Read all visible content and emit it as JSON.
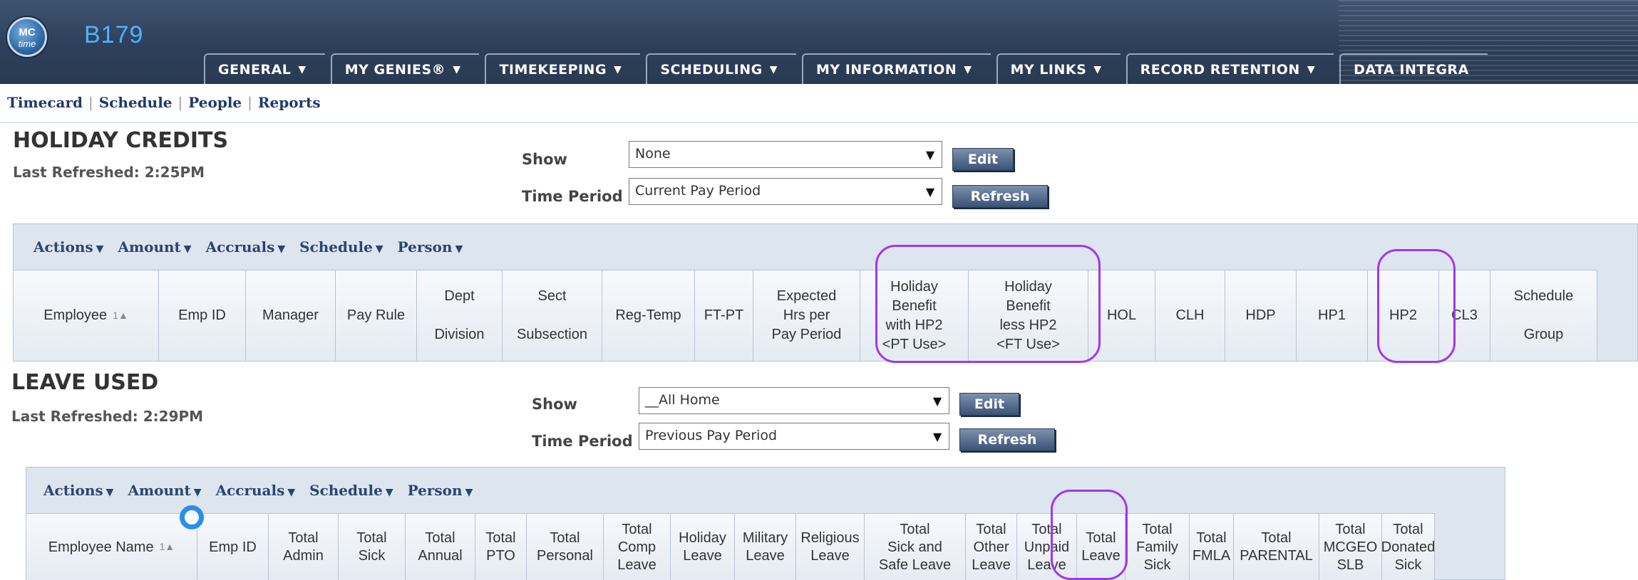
{
  "header": {
    "logo_line1": "MC",
    "logo_line2": "time",
    "site_code": "B179",
    "menu": [
      {
        "label": "GENERAL"
      },
      {
        "label": "MY GENIES®"
      },
      {
        "label": "TIMEKEEPING"
      },
      {
        "label": "SCHEDULING"
      },
      {
        "label": "MY INFORMATION"
      },
      {
        "label": "MY LINKS"
      },
      {
        "label": "RECORD RETENTION"
      },
      {
        "label": "DATA INTEGRA"
      }
    ]
  },
  "subnav": [
    "Timecard",
    "Schedule",
    "People",
    "Reports"
  ],
  "holiday_credits": {
    "title": "HOLIDAY CREDITS",
    "last_refreshed": "Last Refreshed: 2:25PM",
    "show_label": "Show",
    "show_value": "None",
    "edit_label": "Edit",
    "time_period_label": "Time Period",
    "time_period_value": "Current Pay Period",
    "refresh_label": "Refresh",
    "toolbar": [
      "Actions",
      "Amount",
      "Accruals",
      "Schedule",
      "Person"
    ],
    "sort_indicator": "1",
    "columns": [
      "Employee",
      "Emp ID",
      "Manager",
      "Pay Rule",
      "Dept\n\nDivision",
      "Sect\n\nSubsection",
      "Reg-Temp",
      "FT-PT",
      "Expected\nHrs per\nPay Period",
      "Holiday\nBenefit\nwith HP2\n<PT Use>",
      "Holiday\nBenefit\nless HP2\n<FT Use>",
      "HOL",
      "CLH",
      "HDP",
      "HP1",
      "HP2",
      "CL3",
      "Schedule\n\nGroup"
    ]
  },
  "leave_used": {
    "title": "LEAVE USED",
    "last_refreshed": "Last Refreshed: 2:29PM",
    "show_label": "Show",
    "show_value": "__All Home",
    "edit_label": "Edit",
    "time_period_label": "Time Period",
    "time_period_value": "Previous Pay Period",
    "refresh_label": "Refresh",
    "toolbar": [
      "Actions",
      "Amount",
      "Accruals",
      "Schedule",
      "Person"
    ],
    "sort_indicator": "1",
    "columns": [
      "Employee Name",
      "Emp ID",
      "Total\nAdmin",
      "Total\nSick",
      "Total\nAnnual",
      "Total\nPTO",
      "Total\nPersonal",
      "Total\nComp\nLeave",
      "Holiday\nLeave",
      "Military\nLeave",
      "Religious\nLeave",
      "Total\nSick and\nSafe Leave",
      "Total\nOther\nLeave",
      "Total\nUnpaid\nLeave",
      "Total\nLeave",
      "Total\nFamily\nSick",
      "Total\nFMLA",
      "Total\nPARENTAL",
      "Total\nMCGEO\nSLB",
      "Total\nDonated\nSick"
    ]
  },
  "annotations": {
    "highlight_color": "#a237ea"
  }
}
